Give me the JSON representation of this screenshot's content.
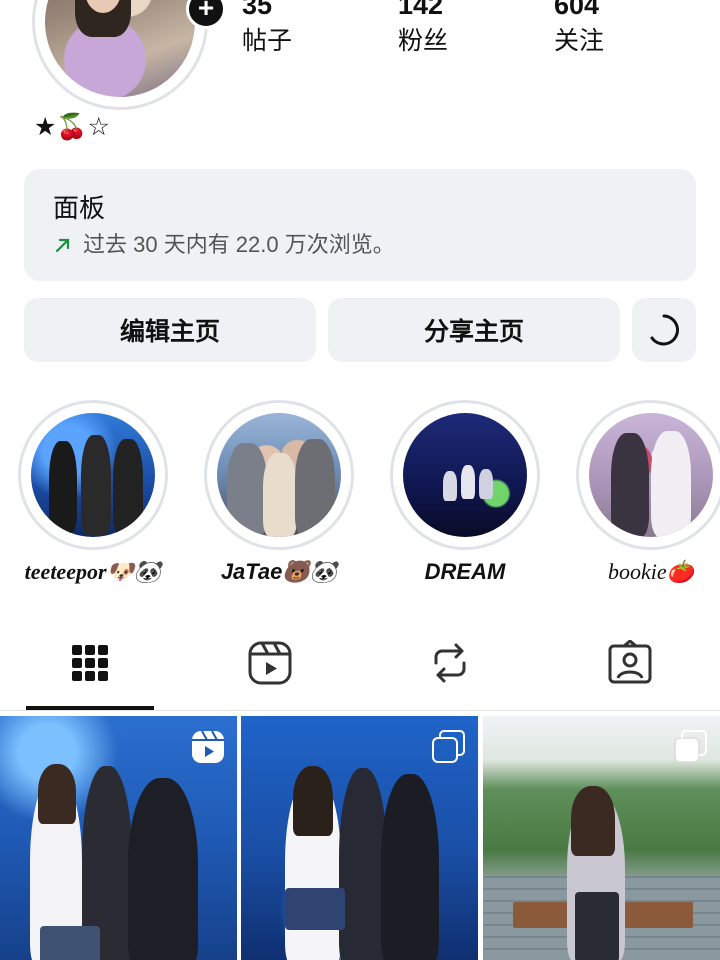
{
  "profile": {
    "stats": [
      {
        "value": "35",
        "label": "帖子"
      },
      {
        "value": "142",
        "label": "粉丝"
      },
      {
        "value": "604",
        "label": "关注"
      }
    ],
    "bio": "★🍒☆"
  },
  "dashboard": {
    "title": "面板",
    "views_text": "过去 30 天内有 22.0 万次浏览。",
    "trend_color": "#1a8f3c"
  },
  "actions": {
    "edit_label": "编辑主页",
    "share_label": "分享主页"
  },
  "highlights": [
    {
      "label": "teeteepor🐶🐼"
    },
    {
      "label": "JaTae🐻🐼"
    },
    {
      "label": "DREAM"
    },
    {
      "label": "bookie🍅"
    }
  ],
  "tabs": [
    {
      "icon": "grid-icon",
      "selected": true
    },
    {
      "icon": "reels-icon",
      "selected": false
    },
    {
      "icon": "reposts-icon",
      "selected": false
    },
    {
      "icon": "tagged-icon",
      "selected": false
    }
  ],
  "posts": [
    {
      "badge": "reel-icon"
    },
    {
      "badge": "carousel-icon"
    },
    {
      "badge": "carousel-icon"
    }
  ]
}
